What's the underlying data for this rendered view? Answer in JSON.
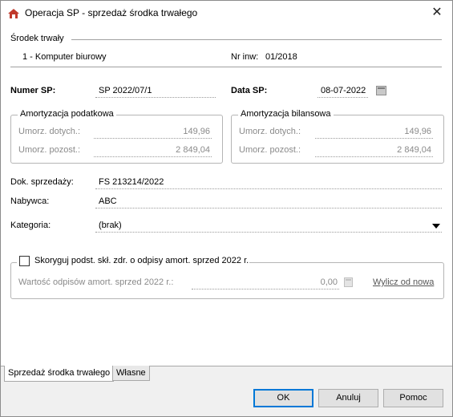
{
  "window": {
    "title": "Operacja SP - sprzedaż środka trwałego",
    "close_glyph": "✕"
  },
  "asset": {
    "section_label": "Środek trwały",
    "name": "1 - Komputer biurowy",
    "inv_label": "Nr inw:",
    "inv_value": "01/2018"
  },
  "header": {
    "numer_label": "Numer SP:",
    "numer_value": "SP 2022/07/1",
    "data_label": "Data SP:",
    "data_value": "08-07-2022"
  },
  "tax_depr": {
    "title": "Amortyzacja podatkowa",
    "umorz_dotych_label": "Umorz. dotych.:",
    "umorz_dotych_value": "149,96",
    "umorz_pozost_label": "Umorz. pozost.:",
    "umorz_pozost_value": "2 849,04"
  },
  "balance_depr": {
    "title": "Amortyzacja bilansowa",
    "umorz_dotych_label": "Umorz. dotych.:",
    "umorz_dotych_value": "149,96",
    "umorz_pozost_label": "Umorz. pozost.:",
    "umorz_pozost_value": "2 849,04"
  },
  "doc": {
    "dok_label": "Dok. sprzedaży:",
    "dok_value": "FS 213214/2022",
    "nabywca_label": "Nabywca:",
    "nabywca_value": "ABC",
    "kategoria_label": "Kategoria:",
    "kategoria_value": "(brak)"
  },
  "correction": {
    "checkbox_label": "Skoryguj podst. skł. zdr. o odpisy amort. sprzed 2022 r.",
    "checked": false,
    "wartosc_label": "Wartość odpisów amort. sprzed 2022 r.:",
    "wartosc_value": "0,00",
    "link_label": "Wylicz od nowa"
  },
  "tabs": [
    {
      "label": "Sprzedaż środka trwałego",
      "active": true
    },
    {
      "label": "Własne",
      "active": false
    }
  ],
  "buttons": {
    "ok": "OK",
    "cancel": "Anuluj",
    "help": "Pomoc"
  },
  "colors": {
    "accent": "#0078d7",
    "app_icon": "#c0392b"
  },
  "icons": [
    "app-icon",
    "close-icon",
    "calendar-icon",
    "dropdown-arrow-icon",
    "calculator-icon"
  ]
}
